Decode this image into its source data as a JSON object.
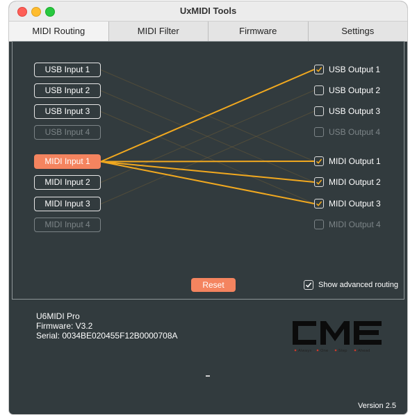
{
  "window": {
    "title": "UxMIDI Tools"
  },
  "tabs": [
    {
      "label": "MIDI Routing",
      "active": true
    },
    {
      "label": "MIDI Filter",
      "active": false
    },
    {
      "label": "Firmware",
      "active": false
    },
    {
      "label": "Settings",
      "active": false
    }
  ],
  "inputs": [
    {
      "label": "USB Input 1",
      "state": "normal"
    },
    {
      "label": "USB Input 2",
      "state": "normal"
    },
    {
      "label": "USB Input 3",
      "state": "normal"
    },
    {
      "label": "USB Input 4",
      "state": "disabled"
    },
    {
      "label": "MIDI Input 1",
      "state": "selected"
    },
    {
      "label": "MIDI Input 2",
      "state": "normal"
    },
    {
      "label": "MIDI Input 3",
      "state": "normal"
    },
    {
      "label": "MIDI Input 4",
      "state": "disabled"
    }
  ],
  "outputs": [
    {
      "label": "USB Output 1",
      "checked": true,
      "enabled": true
    },
    {
      "label": "USB Output 2",
      "checked": false,
      "enabled": true
    },
    {
      "label": "USB Output 3",
      "checked": false,
      "enabled": true
    },
    {
      "label": "USB Output 4",
      "checked": false,
      "enabled": false
    },
    {
      "label": "MIDI Output 1",
      "checked": true,
      "enabled": true
    },
    {
      "label": "MIDI Output 2",
      "checked": true,
      "enabled": true
    },
    {
      "label": "MIDI Output 3",
      "checked": true,
      "enabled": true
    },
    {
      "label": "MIDI Output 4",
      "checked": false,
      "enabled": false
    }
  ],
  "routes_active": [
    [
      4,
      0
    ],
    [
      4,
      4
    ],
    [
      4,
      5
    ],
    [
      4,
      6
    ]
  ],
  "routes_faint": [
    [
      0,
      4
    ],
    [
      1,
      5
    ],
    [
      2,
      6
    ],
    [
      5,
      1
    ],
    [
      6,
      2
    ]
  ],
  "controls": {
    "reset_label": "Reset",
    "advanced_label": "Show advanced  routing",
    "advanced_checked": true
  },
  "device": {
    "name": "U6MIDI Pro",
    "firmware": "Firmware: V3.2",
    "serial": "Serial: 0034BE020455F12B0000708A"
  },
  "logo": {
    "text": "CME",
    "tagline": "Always · One · Step · Ahead"
  },
  "version": "Version 2.5",
  "colors": {
    "accent": "#f4845f",
    "route": "#f2a91f",
    "panel_bg": "#323b3e"
  }
}
